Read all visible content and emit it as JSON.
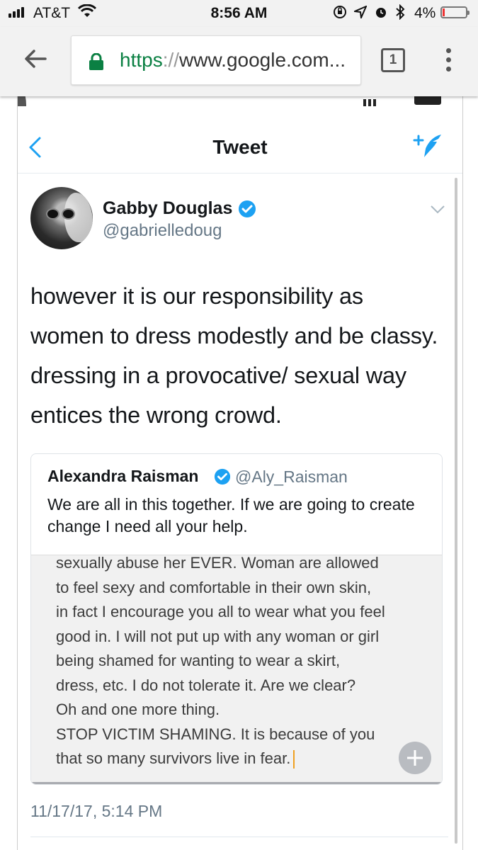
{
  "status_bar": {
    "carrier": "AT&T",
    "time": "8:56 AM",
    "battery_percent": "4%",
    "battery_level": 0.04,
    "icons": [
      "signal-icon",
      "wifi-icon",
      "orientation-lock-icon",
      "location-icon",
      "alarm-icon",
      "bluetooth-icon",
      "battery-icon"
    ]
  },
  "browser": {
    "url_scheme": "https",
    "url_sep": "://",
    "url_rest": "www.google.com...",
    "tab_count": "1",
    "icons": [
      "back-arrow-icon",
      "lock-icon",
      "tabs-icon",
      "overflow-menu-icon"
    ]
  },
  "tweet_page": {
    "nav_title": "Tweet",
    "author": {
      "name": "Gabby Douglas",
      "handle": "@gabrielledoug"
    },
    "text": "however it is our responsibility as women to dress modestly and be classy. dressing in a provocative/ sexual way entices the wrong crowd.",
    "quoted": {
      "name": "Alexandra Raisman",
      "handle": "@Aly_Raisman",
      "text": "We are all in this together. If we are going to create change I need all your help.",
      "image_lines": [
        "sexually abuse her EVER. Woman are allowed",
        "to feel sexy and comfortable in their own skin,",
        "in fact I encourage you all to wear what you feel",
        "good in. I will not put up with any woman or girl",
        "being shamed for wanting to wear a skirt,",
        "dress, etc. I do not tolerate it. Are we clear?",
        "Oh and one more thing.",
        "STOP VICTIM SHAMING. It is because of you",
        "that so many survivors live in fear."
      ]
    },
    "timestamp": "11/17/17, 5:14 PM"
  },
  "colors": {
    "twitter_blue": "#1da1f2",
    "verified_blue": "#1da1f2",
    "secure_green": "#0b8043",
    "gray_text": "#657786"
  }
}
